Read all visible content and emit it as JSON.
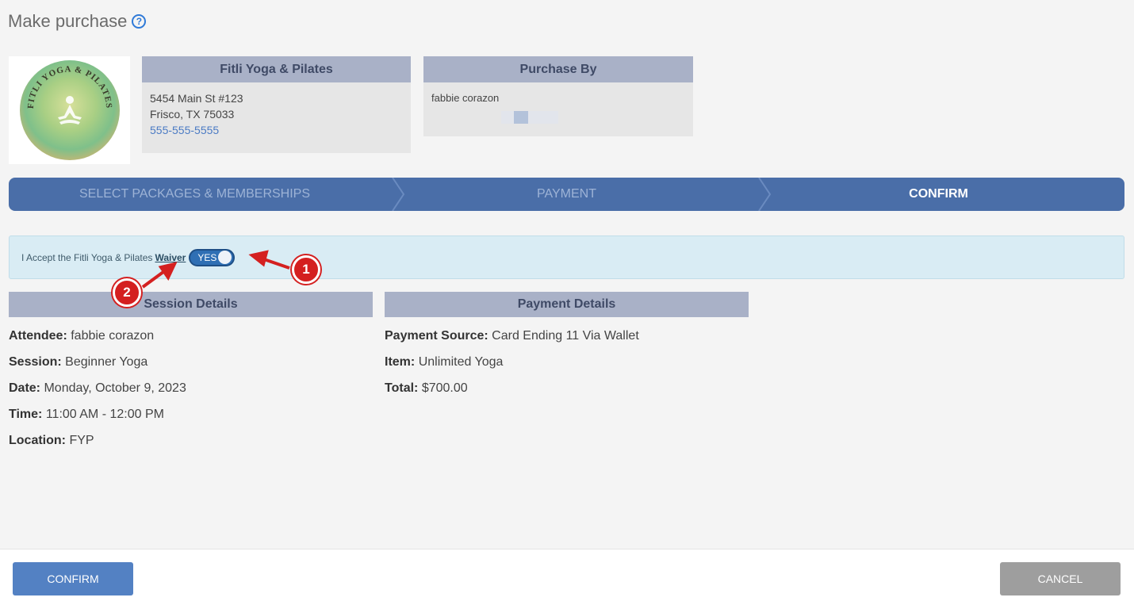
{
  "page": {
    "title": "Make purchase",
    "help_icon": "question-circle-icon"
  },
  "business": {
    "name": "Fitli Yoga & Pilates",
    "address_line1": "5454 Main St #123",
    "address_line2": "Frisco, TX 75033",
    "phone": "555-555-5555"
  },
  "logo": {
    "text": "FITLI YOGA & PILATES"
  },
  "purchase_by": {
    "heading": "Purchase By",
    "name": "fabbie corazon"
  },
  "steps": [
    {
      "label": "SELECT PACKAGES & MEMBERSHIPS",
      "active": false
    },
    {
      "label": "PAYMENT",
      "active": false
    },
    {
      "label": "CONFIRM",
      "active": true
    }
  ],
  "waiver": {
    "text": "I Accept the Fitli Yoga & Pilates",
    "link": "Waiver",
    "toggle_label": "YES",
    "accepted": true
  },
  "session_details": {
    "heading": "Session Details",
    "rows": [
      {
        "label": "Attendee:",
        "value": "fabbie corazon"
      },
      {
        "label": "Session:",
        "value": "Beginner Yoga"
      },
      {
        "label": "Date:",
        "value": "Monday, October 9, 2023"
      },
      {
        "label": "Time:",
        "value": "11:00 AM - 12:00 PM"
      },
      {
        "label": "Location:",
        "value": "FYP"
      }
    ]
  },
  "payment_details": {
    "heading": "Payment Details",
    "rows": [
      {
        "label": "Payment Source:",
        "value": "Card Ending 11 Via Wallet"
      },
      {
        "label": "Item:",
        "value": "Unlimited Yoga"
      },
      {
        "label": "Total:",
        "value": "$700.00"
      }
    ]
  },
  "footer": {
    "confirm_label": "CONFIRM",
    "cancel_label": "CANCEL"
  },
  "annotations": {
    "badge1": "1",
    "badge2": "2"
  },
  "colors": {
    "step_bar": "#4a6ea8",
    "header_band": "#a9b1c7",
    "confirm_button": "#5381c3",
    "cancel_button": "#9e9e9e",
    "annotation": "#d42020"
  }
}
